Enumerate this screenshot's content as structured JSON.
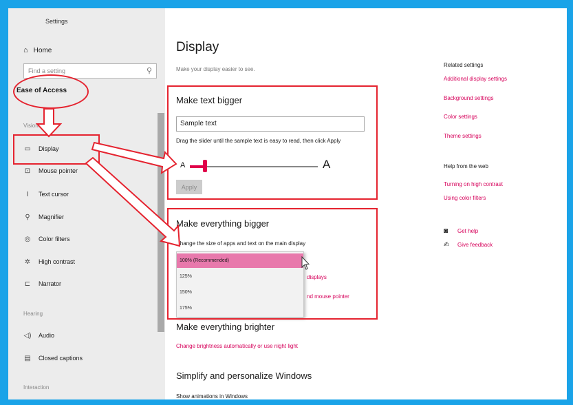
{
  "sidebar": {
    "title": "Settings",
    "home": "Home",
    "search_placeholder": "Find a setting",
    "section": "Ease of Access",
    "groups": {
      "vision": "Vision",
      "hearing": "Hearing",
      "interaction": "Interaction"
    },
    "items": [
      {
        "label": "Display",
        "icon": "monitor-icon"
      },
      {
        "label": "Mouse pointer",
        "icon": "mouse-pointer-icon"
      },
      {
        "label": "Text cursor",
        "icon": "text-cursor-icon"
      },
      {
        "label": "Magnifier",
        "icon": "magnifier-icon"
      },
      {
        "label": "Color filters",
        "icon": "color-filters-icon"
      },
      {
        "label": "High contrast",
        "icon": "high-contrast-icon"
      },
      {
        "label": "Narrator",
        "icon": "narrator-icon"
      },
      {
        "label": "Audio",
        "icon": "audio-icon"
      },
      {
        "label": "Closed captions",
        "icon": "closed-captions-icon"
      }
    ]
  },
  "main": {
    "title": "Display",
    "description": "Make your display easier to see.",
    "text_bigger": {
      "title": "Make text bigger",
      "sample": "Sample text",
      "hint": "Drag the slider until the sample text is easy to read, then click Apply",
      "slider_min": "A",
      "slider_max": "A",
      "slider_value": 0.12,
      "apply": "Apply"
    },
    "everything_bigger": {
      "title": "Make everything bigger",
      "subtitle": "Change the size of apps and text on the main display",
      "options": [
        "100% (Recommended)",
        "125%",
        "150%",
        "175%"
      ],
      "link1_partial": "displays",
      "link2_partial": "nd mouse pointer"
    },
    "brighter": {
      "title": "Make everything brighter",
      "link": "Change brightness automatically or use night light"
    },
    "simplify": {
      "title": "Simplify and personalize Windows",
      "item": "Show animations in Windows"
    }
  },
  "related": {
    "heading": "Related settings",
    "links": [
      "Additional display settings",
      "Background settings",
      "Color settings",
      "Theme settings"
    ],
    "help_heading": "Help from the web",
    "help_links": [
      "Turning on high contrast",
      "Using color filters"
    ],
    "get_help": "Get help",
    "give_feedback": "Give feedback"
  },
  "colors": {
    "accent": "#d6005a",
    "annotation": "#e5232f",
    "frame": "#1aa3e8"
  }
}
